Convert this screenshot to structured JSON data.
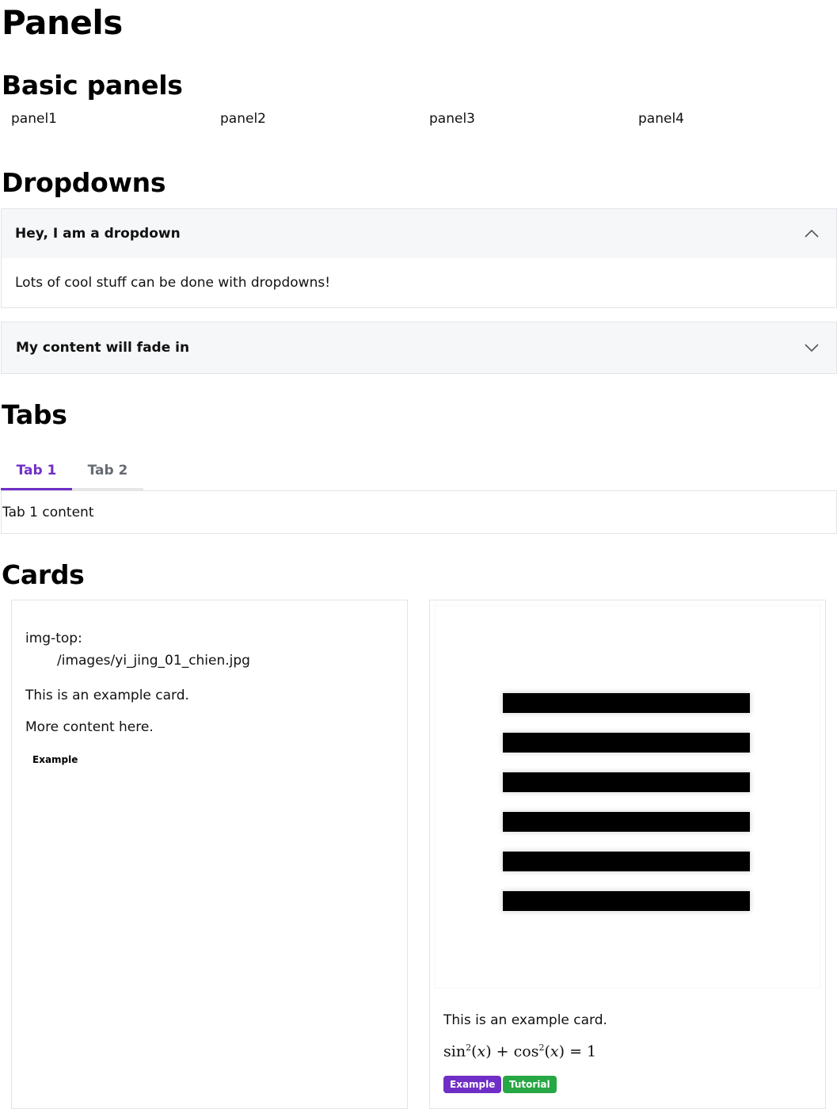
{
  "page": {
    "title": "Panels"
  },
  "sections": {
    "basic_panels": "Basic panels",
    "dropdowns": "Dropdowns",
    "tabs": "Tabs",
    "cards": "Cards"
  },
  "panels": [
    "panel1",
    "panel2",
    "panel3",
    "panel4"
  ],
  "dropdowns": [
    {
      "title": "Hey, I am a dropdown",
      "body": "Lots of cool stuff can be done with dropdowns!",
      "expanded": true,
      "icon": "chevron-up-icon"
    },
    {
      "title": "My content will fade in",
      "expanded": false,
      "icon": "chevron-down-icon"
    }
  ],
  "tabs": {
    "items": [
      "Tab 1",
      "Tab 2"
    ],
    "active": "Tab 1",
    "content": "Tab 1 content",
    "accent": "#7030c8"
  },
  "cards": [
    {
      "img_top_label": "img-top:",
      "img_top_value": "/images/yi_jing_01_chien.jpg",
      "text": "This is an example card.",
      "more": "More content here.",
      "badge": "Example"
    },
    {
      "image": "hexagram-six-lines",
      "text": "This is an example card.",
      "math": {
        "sin": "sin",
        "cos": "cos",
        "x": "x",
        "exp": "2",
        "eq": "= 1"
      },
      "badges": [
        {
          "label": "Example",
          "color": "#6f2fc7"
        },
        {
          "label": "Tutorial",
          "color": "#27a745"
        }
      ]
    }
  ]
}
